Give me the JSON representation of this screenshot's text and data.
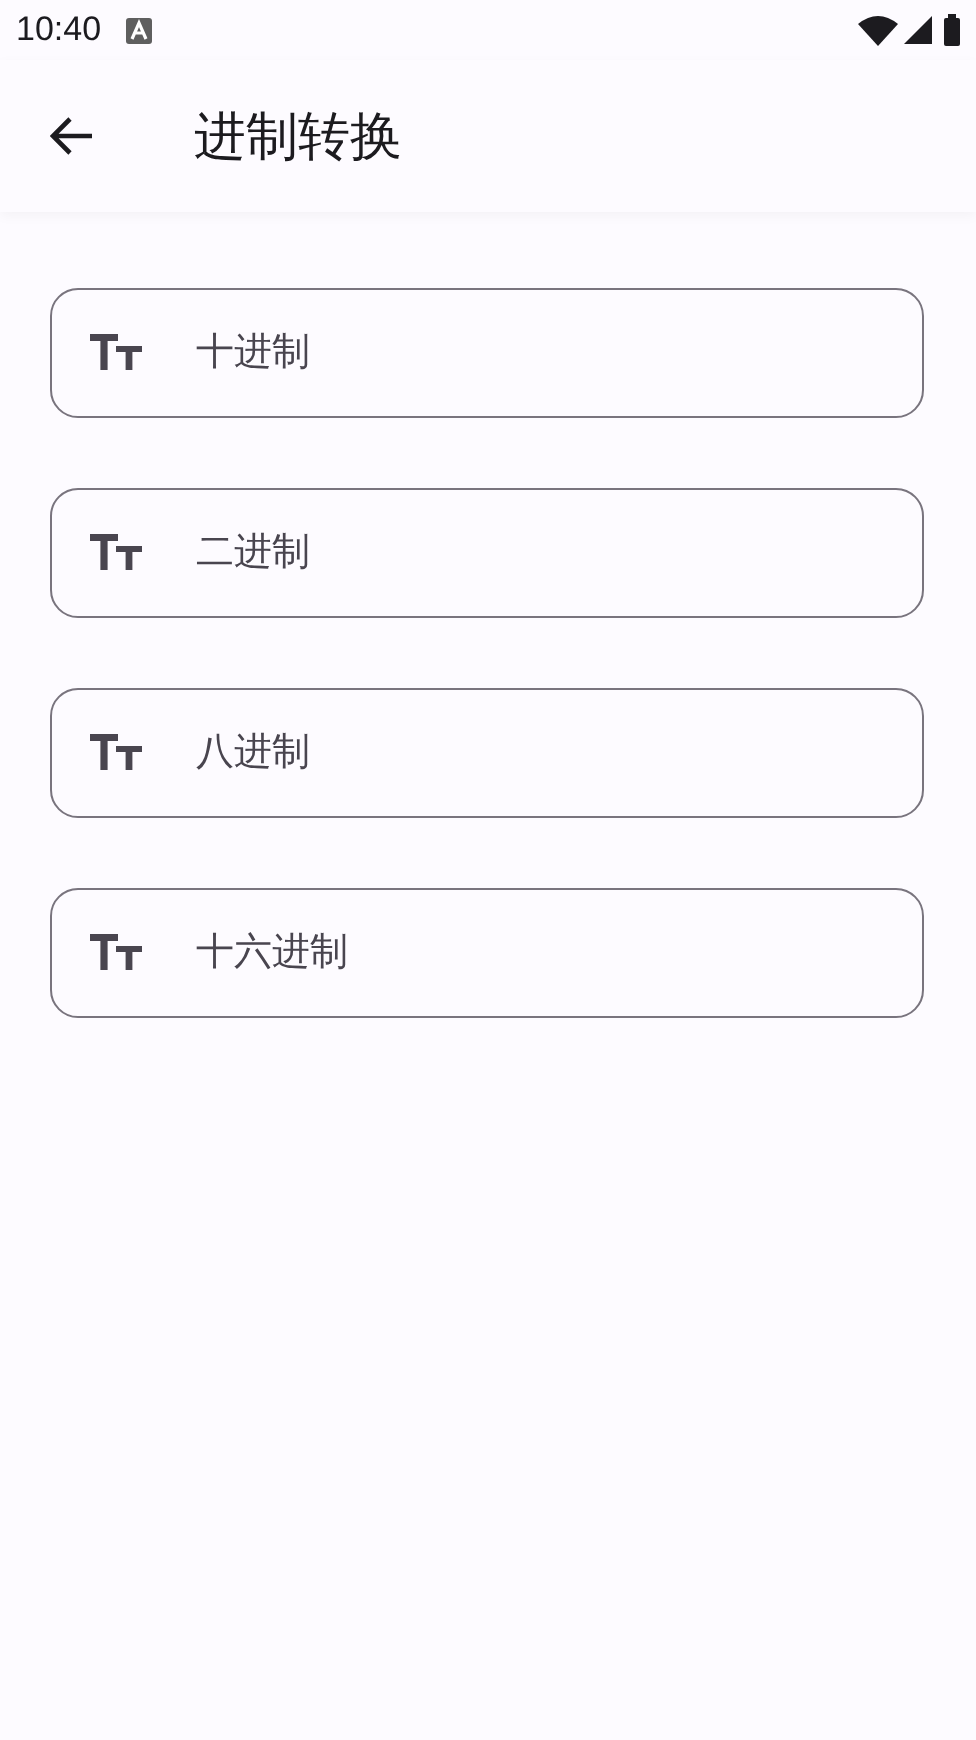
{
  "status_bar": {
    "time": "10:40"
  },
  "app_bar": {
    "title": "进制转换"
  },
  "fields": [
    {
      "placeholder": "十进制"
    },
    {
      "placeholder": "二进制"
    },
    {
      "placeholder": "八进制"
    },
    {
      "placeholder": "十六进制"
    }
  ]
}
